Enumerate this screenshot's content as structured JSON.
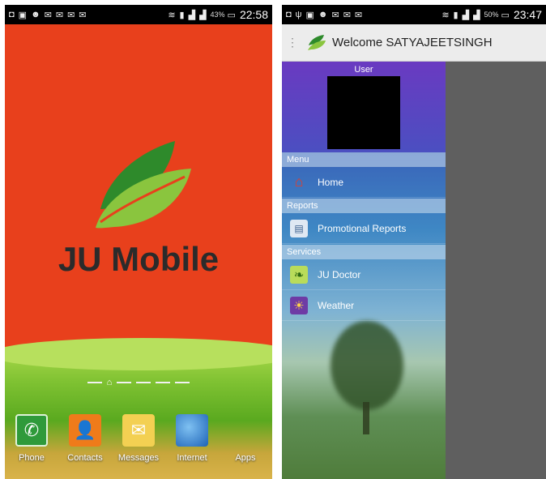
{
  "left_screen": {
    "status_bar": {
      "icons": [
        "notification-icon",
        "image-icon",
        "emoji-icon",
        "mail-icon",
        "mail-icon",
        "mail-icon",
        "mail-icon",
        "wifi-icon",
        "sim-icon",
        "signal-icon",
        "signal-icon"
      ],
      "battery_percent": "43%",
      "time": "22:58"
    },
    "splash_title": "JU Mobile",
    "dock": [
      {
        "label": "Phone",
        "icon": "phone-icon"
      },
      {
        "label": "Contacts",
        "icon": "contacts-icon"
      },
      {
        "label": "Messages",
        "icon": "messages-icon"
      },
      {
        "label": "Internet",
        "icon": "internet-icon"
      },
      {
        "label": "Apps",
        "icon": "apps-icon"
      }
    ]
  },
  "right_screen": {
    "status_bar": {
      "icons": [
        "notification-icon",
        "usb-icon",
        "image-icon",
        "emoji-icon",
        "mail-icon",
        "mail-icon",
        "mail-icon",
        "wifi-icon",
        "sim-icon",
        "signal-icon",
        "signal-icon"
      ],
      "battery_percent": "50%",
      "time": "23:47"
    },
    "action_bar": {
      "title": "Welcome SATYAJEETSINGH"
    },
    "drawer": {
      "user_label": "User",
      "sections": [
        {
          "header": "Menu",
          "items": [
            {
              "label": "Home",
              "icon": "home-icon"
            }
          ]
        },
        {
          "header": "Reports",
          "items": [
            {
              "label": "Promotional Reports",
              "icon": "report-icon"
            }
          ]
        },
        {
          "header": "Services",
          "items": [
            {
              "label": "JU Doctor",
              "icon": "doctor-icon"
            },
            {
              "label": "Weather",
              "icon": "weather-icon"
            }
          ]
        }
      ]
    }
  },
  "colors": {
    "splash_background": "#e8401c",
    "leaf_green": "#8ac53e",
    "leaf_dark": "#2e8a2b"
  }
}
